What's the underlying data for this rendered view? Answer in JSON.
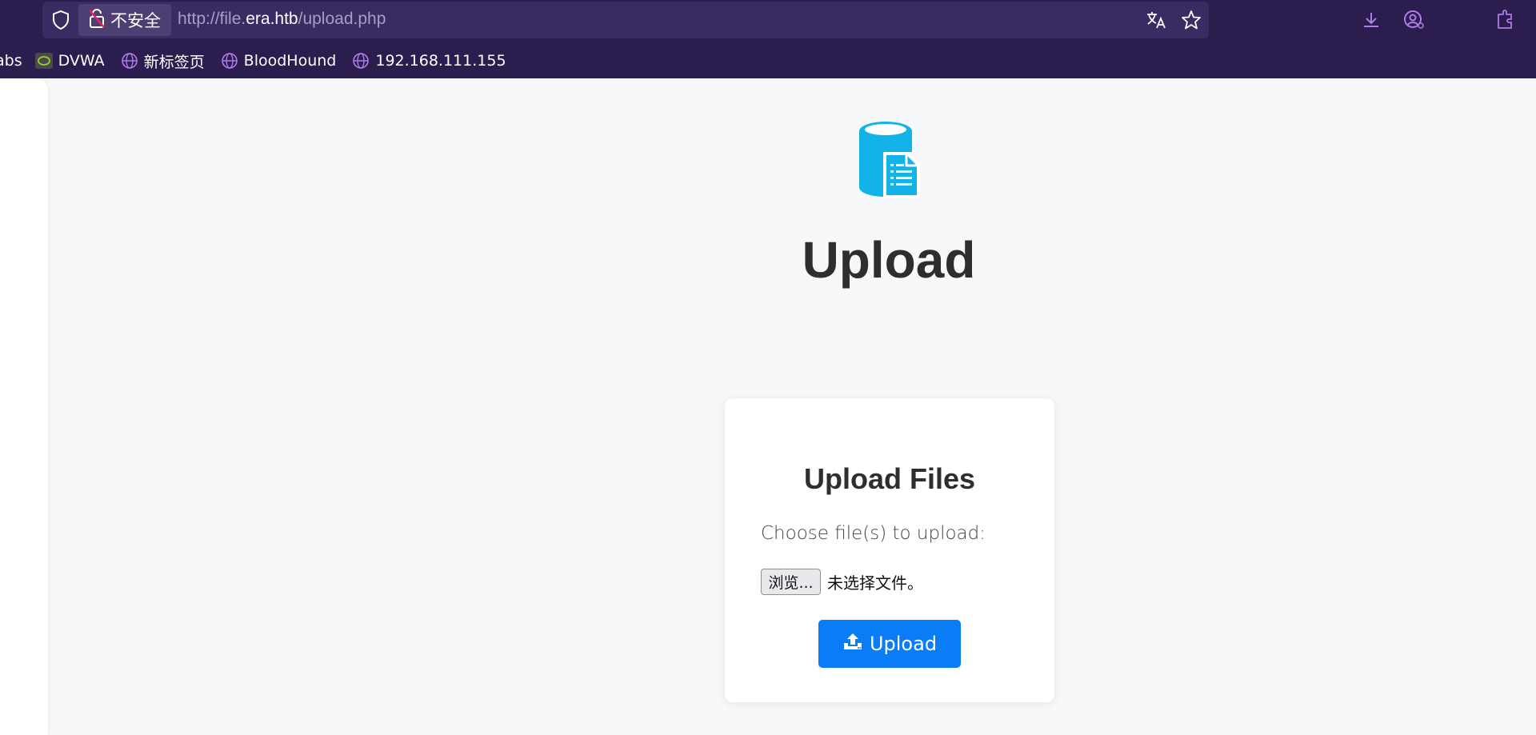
{
  "browser": {
    "security_label": "不安全",
    "url_prefix": "http://file.",
    "url_host": "era.htb",
    "url_path": "/upload.php",
    "bookmarks": [
      {
        "label": "abs",
        "icon": "none"
      },
      {
        "label": "DVWA",
        "icon": "dvwa-icon"
      },
      {
        "label": "新标签页",
        "icon": "globe-icon"
      },
      {
        "label": "BloodHound",
        "icon": "globe-icon"
      },
      {
        "label": "192.168.111.155",
        "icon": "globe-icon"
      }
    ],
    "accent": "#2b1d4e"
  },
  "page": {
    "hero_icon": "database-document-icon",
    "title": "Upload",
    "card": {
      "title": "Upload Files",
      "choose_label": "Choose file(s) to upload:",
      "browse_label": "浏览...",
      "no_file_text": "未选择文件。",
      "upload_label": "Upload",
      "upload_icon": "upload-icon",
      "button_color": "#0a7cf5"
    }
  }
}
